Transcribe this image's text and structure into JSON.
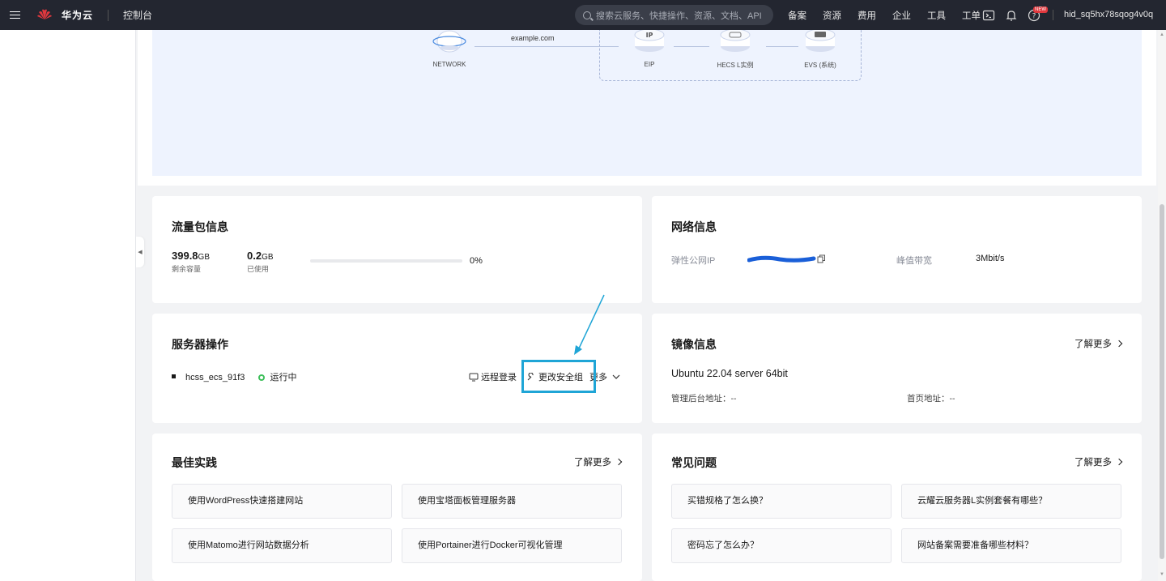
{
  "topbar": {
    "brand": "华为云",
    "console": "控制台",
    "search_placeholder": "搜索云服务、快捷操作、资源、文档、API",
    "nav": [
      "备案",
      "资源",
      "费用",
      "企业",
      "工具",
      "工单"
    ],
    "new_badge": "NEW",
    "user": "hid_sq5hx78sqog4v0q"
  },
  "diagram": {
    "network_label": "NETWORK",
    "domain": "example.com",
    "eip_label": "EIP",
    "hecs_label": "HECS L实例",
    "evs_label": "EVS (系统)"
  },
  "traffic": {
    "title": "流量包信息",
    "remaining_value": "399.8",
    "remaining_unit": "GB",
    "remaining_label": "剩余容量",
    "used_value": "0.2",
    "used_unit": "GB",
    "used_label": "已使用",
    "percent_text": "0%",
    "percent_value": 0
  },
  "network": {
    "title": "网络信息",
    "eip_label": "弹性公网IP",
    "bandwidth_label": "峰值带宽",
    "bandwidth_value": "3Mbit/s"
  },
  "server_ops": {
    "title": "服务器操作",
    "server_name": "hcss_ecs_91f3",
    "status": "运行中",
    "remote_login": "远程登录",
    "change_sg": "更改安全组",
    "more": "更多"
  },
  "image": {
    "title": "镜像信息",
    "more": "了解更多",
    "os": "Ubuntu 22.04 server 64bit",
    "admin_label": "管理后台地址：",
    "admin_value": "--",
    "home_label": "首页地址：",
    "home_value": "--"
  },
  "best_practice": {
    "title": "最佳实践",
    "more": "了解更多",
    "items": [
      "使用WordPress快速搭建网站",
      "使用宝塔面板管理服务器",
      "使用Matomo进行网站数据分析",
      "使用Portainer进行Docker可视化管理"
    ]
  },
  "faq": {
    "title": "常见问题",
    "more": "了解更多",
    "items": [
      "买错规格了怎么换？",
      "云耀云服务器L实例套餐有哪些？",
      "密码忘了怎么办？",
      "网站备案需要准备哪些材料？"
    ]
  },
  "colors": {
    "topbar": "#232630",
    "accent": "#5e7ce0",
    "running": "#3dbf5a",
    "highlight": "#1fa5d6"
  }
}
